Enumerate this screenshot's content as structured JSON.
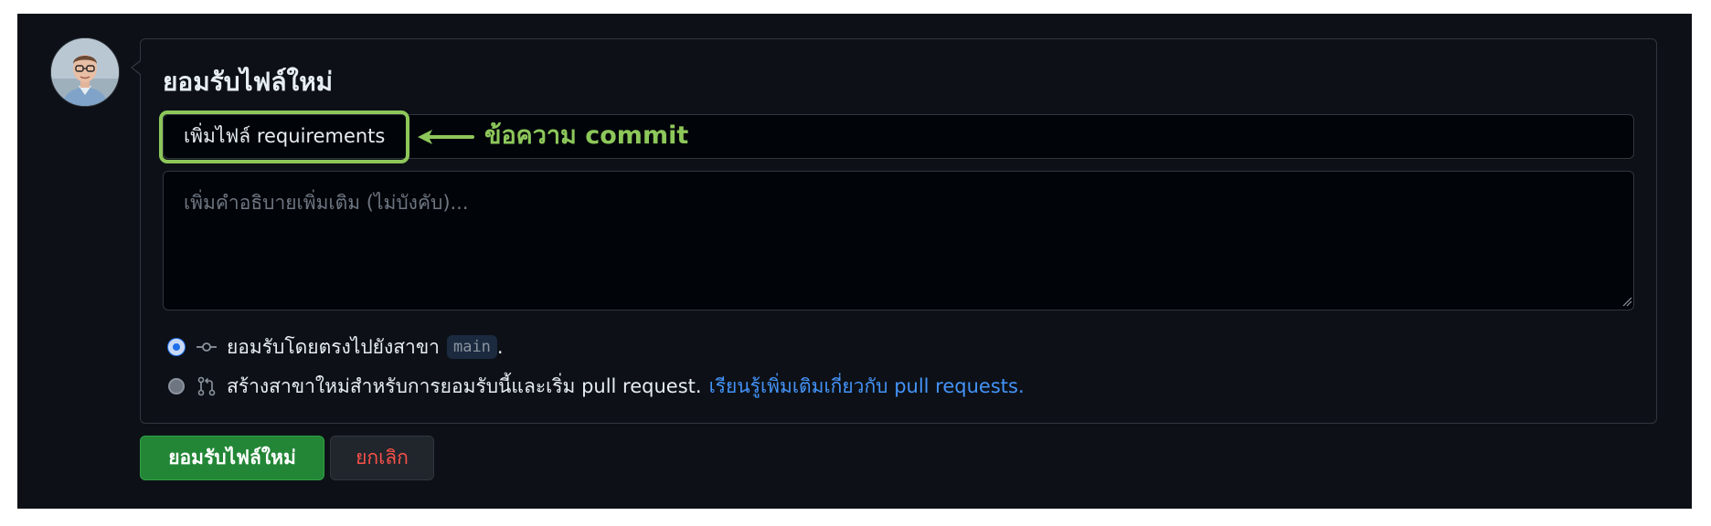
{
  "commit_form": {
    "title": "ยอมรับไฟล์ใหม่",
    "summary_value": "เพิ่มไฟล์ requirements",
    "description_placeholder": "เพิ่มคำอธิบายเพิ่มเติม (ไม่บังคับ)...",
    "option_direct_text": "ยอมรับโดยตรงไปยังสาขา",
    "branch_name": "main",
    "option_direct_suffix": ".",
    "option_pr_text": "สร้างสาขาใหม่สำหรับการยอมรับนี้และเริ่ม pull request.",
    "option_pr_link": "เรียนรู้เพิ่มเติมเกี่ยวกับ pull requests.",
    "selected_option": "direct",
    "commit_button": "ยอมรับไฟล์ใหม่",
    "cancel_button": "ยกเลิก"
  },
  "annotation": {
    "label": "ข้อความ commit",
    "color": "#8dc75a"
  },
  "icons": {
    "avatar": "user-avatar",
    "direct_commit": "git-commit-icon",
    "pull_request": "git-pull-request-icon"
  },
  "colors": {
    "background": "#0d1117",
    "border": "#30363d",
    "primary_button": "#238636",
    "danger_text": "#f85149",
    "link": "#4493f8",
    "radio_selected": "#1f6feb"
  }
}
